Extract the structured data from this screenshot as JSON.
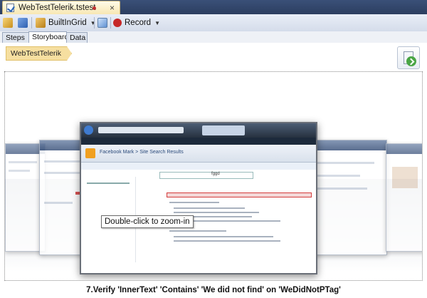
{
  "document_tab": {
    "title": "WebTestTelerik.tstest",
    "close_glyph": "×"
  },
  "toolbar": {
    "builtin_label": "BuiltInGrid",
    "record_label": "Record",
    "record_color": "#c62828"
  },
  "subtabs": [
    {
      "label": "Steps"
    },
    {
      "label": "Storyboard"
    },
    {
      "label": "Data"
    }
  ],
  "storyboard": {
    "breadcrumb": "WebTestTelerik",
    "tooltip": "Double-click to zoom-in",
    "caption": "7.Verify 'InnerText' 'Contains' 'We did not find' on 'WeDidNotPTag'",
    "screenshot_page": {
      "site_title": "Facebook Mark > Site Search Results",
      "search_value": "fggd"
    }
  },
  "icons": {
    "file": "file-check-icon",
    "export": "export-green-arrow-icon",
    "record": "record-dot-icon"
  }
}
